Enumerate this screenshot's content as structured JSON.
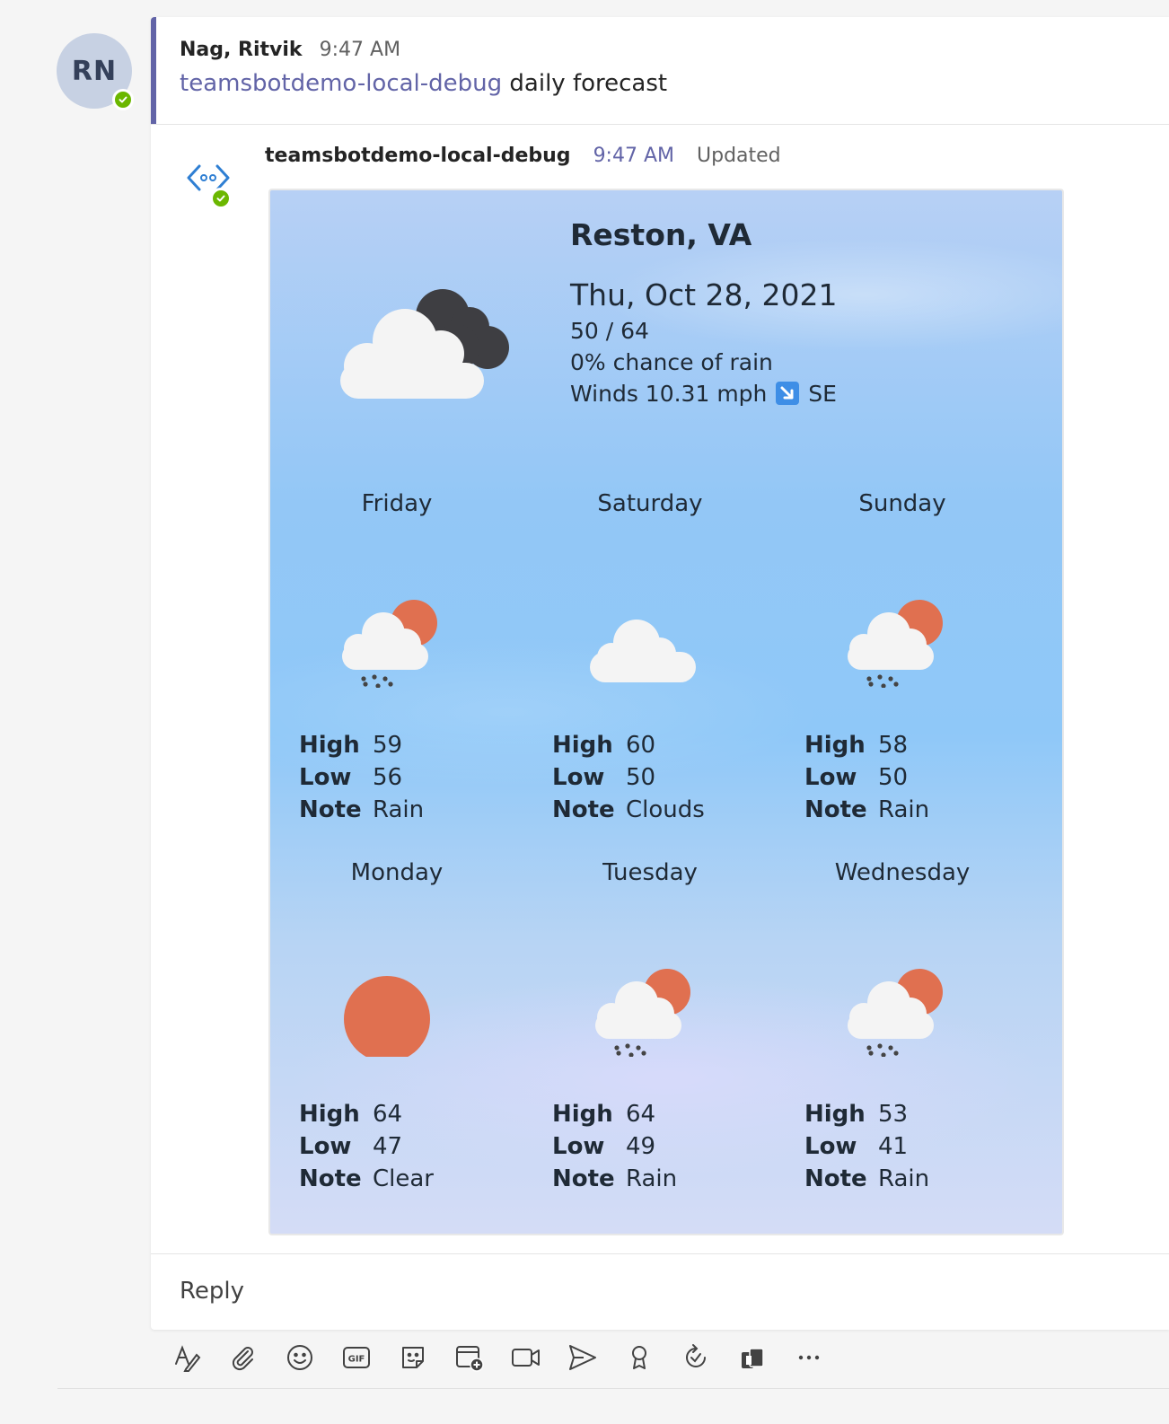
{
  "user": {
    "initials": "RN",
    "name": "Nag, Ritvik",
    "time": "9:47 AM"
  },
  "root_message": {
    "mention": "teamsbotdemo-local-debug",
    "text": "daily forecast"
  },
  "bot_reply": {
    "bot_name": "teamsbotdemo-local-debug",
    "time": "9:47 AM",
    "status": "Updated"
  },
  "card": {
    "city": "Reston, VA",
    "date": "Thu, Oct 28, 2021",
    "temps": "50 / 64",
    "rain": "0% chance of rain",
    "winds_prefix": "Winds 10.31 mph",
    "winds_dir": "SE",
    "current_icon": "partly-cloudy-dark-icon",
    "labels": {
      "high": "High",
      "low": "Low",
      "note": "Note"
    },
    "days": [
      {
        "name": "Friday",
        "high": "59",
        "low": "56",
        "note": "Rain",
        "icon": "rain-sun-icon"
      },
      {
        "name": "Saturday",
        "high": "60",
        "low": "50",
        "note": "Clouds",
        "icon": "cloud-icon"
      },
      {
        "name": "Sunday",
        "high": "58",
        "low": "50",
        "note": "Rain",
        "icon": "rain-sun-icon"
      },
      {
        "name": "Monday",
        "high": "64",
        "low": "47",
        "note": "Clear",
        "icon": "sun-icon"
      },
      {
        "name": "Tuesday",
        "high": "64",
        "low": "49",
        "note": "Rain",
        "icon": "rain-sun-icon"
      },
      {
        "name": "Wednesday",
        "high": "53",
        "low": "41",
        "note": "Rain",
        "icon": "rain-sun-icon"
      }
    ]
  },
  "reply_box": {
    "label": "Reply"
  },
  "colors": {
    "accent": "#6264a7",
    "presence": "#6bb700",
    "sun": "#e07050"
  },
  "toolbar": {
    "items": [
      "format-icon",
      "attach-icon",
      "emoji-icon",
      "gif-icon",
      "sticker-icon",
      "schedule-meeting-icon",
      "meet-now-icon",
      "send-icon",
      "praise-icon",
      "loop-icon",
      "app-icon",
      "more-options-icon"
    ]
  }
}
